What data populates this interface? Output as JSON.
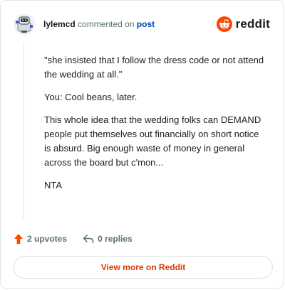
{
  "comment": {
    "username": "lylemcd",
    "action_text": "commented on",
    "post_link_label": "post",
    "paragraphs": [
      "\"she insisted that I follow the dress code or not attend the wedding at all.\"",
      "You: Cool beans, later.",
      "This whole idea that the wedding folks can DEMAND people put themselves out financially on short notice is absurd. Big enough waste of money in general across the board but c'mon...",
      "NTA"
    ]
  },
  "brand": {
    "wordmark": "reddit",
    "logo_icon": "reddit-alien-icon",
    "color": "#ff4500"
  },
  "stats": {
    "upvotes_label": "2 upvotes",
    "upvote_icon": "upvote-arrow-icon",
    "upvote_color": "#ff4500",
    "replies_label": "0 replies",
    "reply_icon": "reply-arrow-icon"
  },
  "footer": {
    "view_more_label": "View more on Reddit",
    "accent_color": "#d93a00"
  }
}
